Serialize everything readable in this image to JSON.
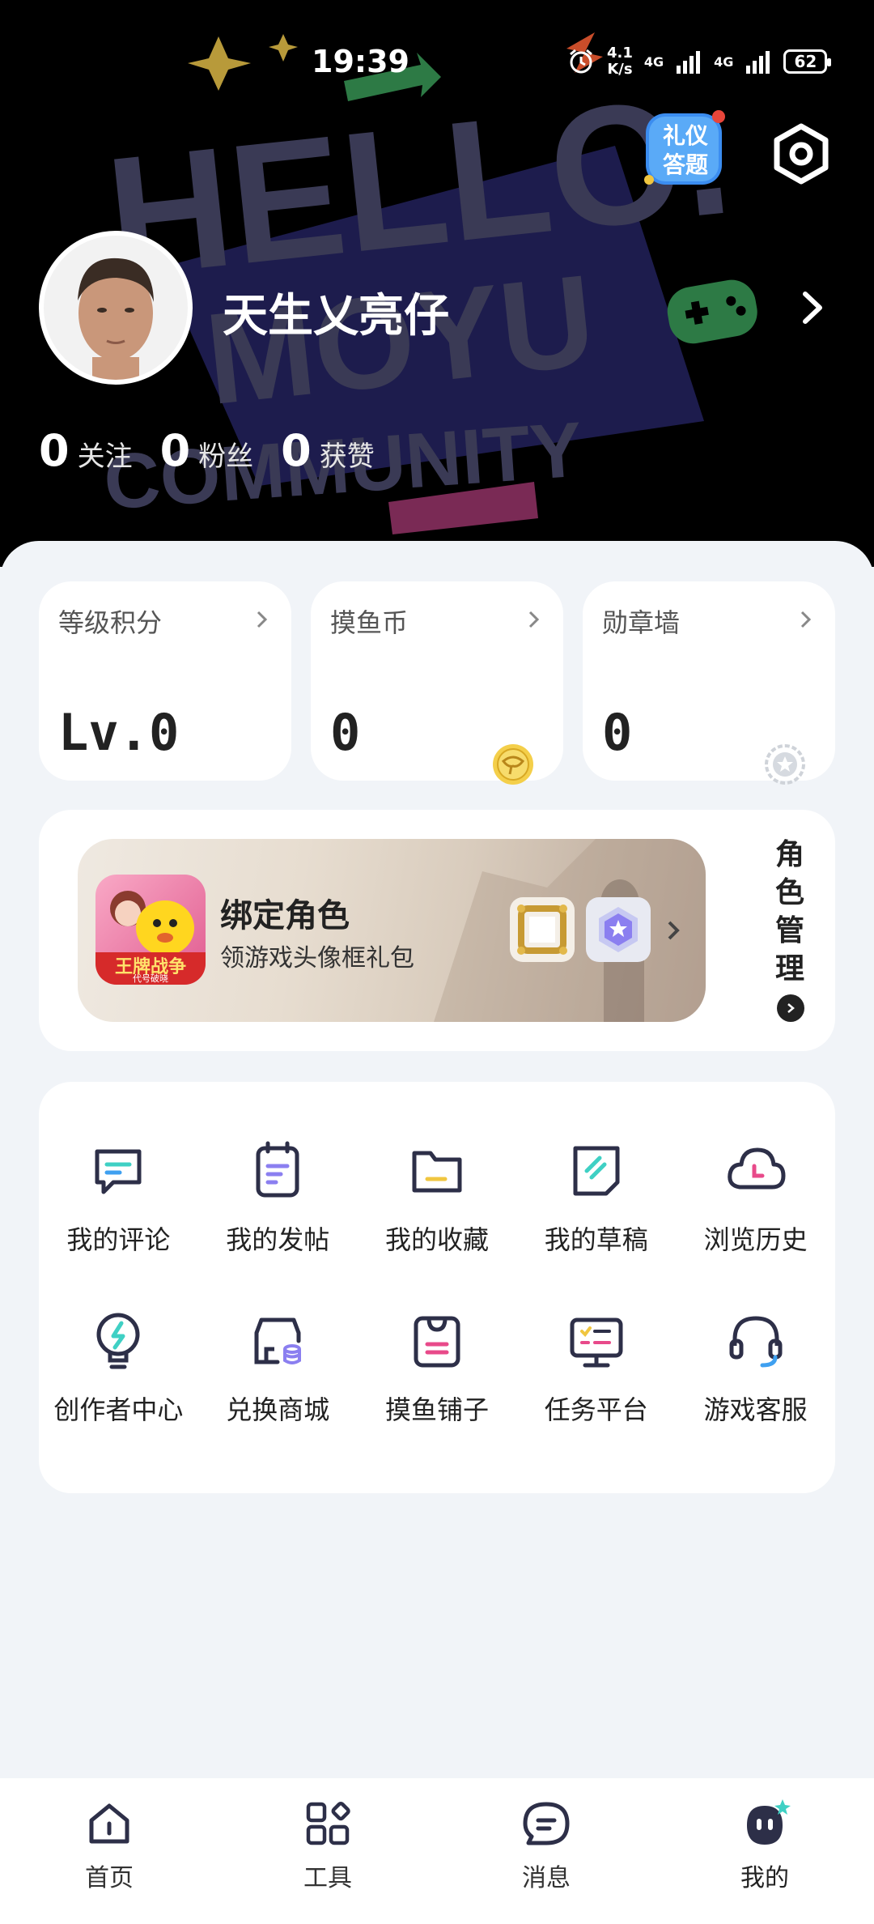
{
  "status_bar": {
    "time": "19:39",
    "net_speed_value": "4.1",
    "net_speed_unit": "K/s",
    "sim1": "4G",
    "sim2": "4G",
    "battery": "62"
  },
  "header": {
    "background_art_text": "HELLO. MOYU COMMUNITY",
    "quiz_badge_line1": "礼仪",
    "quiz_badge_line2": "答题",
    "username": "天生乂亮仔",
    "stats": [
      {
        "value": "0",
        "label": "关注"
      },
      {
        "value": "0",
        "label": "粉丝"
      },
      {
        "value": "0",
        "label": "获赞"
      }
    ]
  },
  "cards": [
    {
      "title": "等级积分",
      "value": "Lv.0",
      "icon": "none"
    },
    {
      "title": "摸鱼币",
      "value": "0",
      "icon": "coin-icon"
    },
    {
      "title": "勋章墙",
      "value": "0",
      "icon": "medal-icon"
    }
  ],
  "bind_role": {
    "title": "绑定角色",
    "subtitle": "领游戏头像框礼包",
    "game_icon_text": "王牌战争",
    "game_icon_subtext": "代号破晓",
    "manage_label": "角色管理"
  },
  "functions": [
    {
      "label": "我的评论",
      "icon": "comment-icon"
    },
    {
      "label": "我的发帖",
      "icon": "post-icon"
    },
    {
      "label": "我的收藏",
      "icon": "folder-icon"
    },
    {
      "label": "我的草稿",
      "icon": "draft-icon"
    },
    {
      "label": "浏览历史",
      "icon": "history-icon"
    },
    {
      "label": "创作者中心",
      "icon": "lightbulb-icon"
    },
    {
      "label": "兑换商城",
      "icon": "store-icon"
    },
    {
      "label": "摸鱼铺子",
      "icon": "shop-bag-icon"
    },
    {
      "label": "任务平台",
      "icon": "task-icon"
    },
    {
      "label": "游戏客服",
      "icon": "headset-icon"
    }
  ],
  "tabbar": {
    "items": [
      {
        "label": "首页",
        "icon": "home-icon"
      },
      {
        "label": "工具",
        "icon": "tools-icon"
      },
      {
        "label": "消息",
        "icon": "message-icon"
      },
      {
        "label": "我的",
        "icon": "profile-icon"
      }
    ],
    "active_index": 3
  },
  "colors": {
    "header_bg": "#000000",
    "art_color": "#3a3a55",
    "accent_cyan": "#3fd0c4",
    "accent_pink": "#e84a8a",
    "accent_yellow": "#f0c640",
    "accent_purple": "#8b7ff0"
  }
}
